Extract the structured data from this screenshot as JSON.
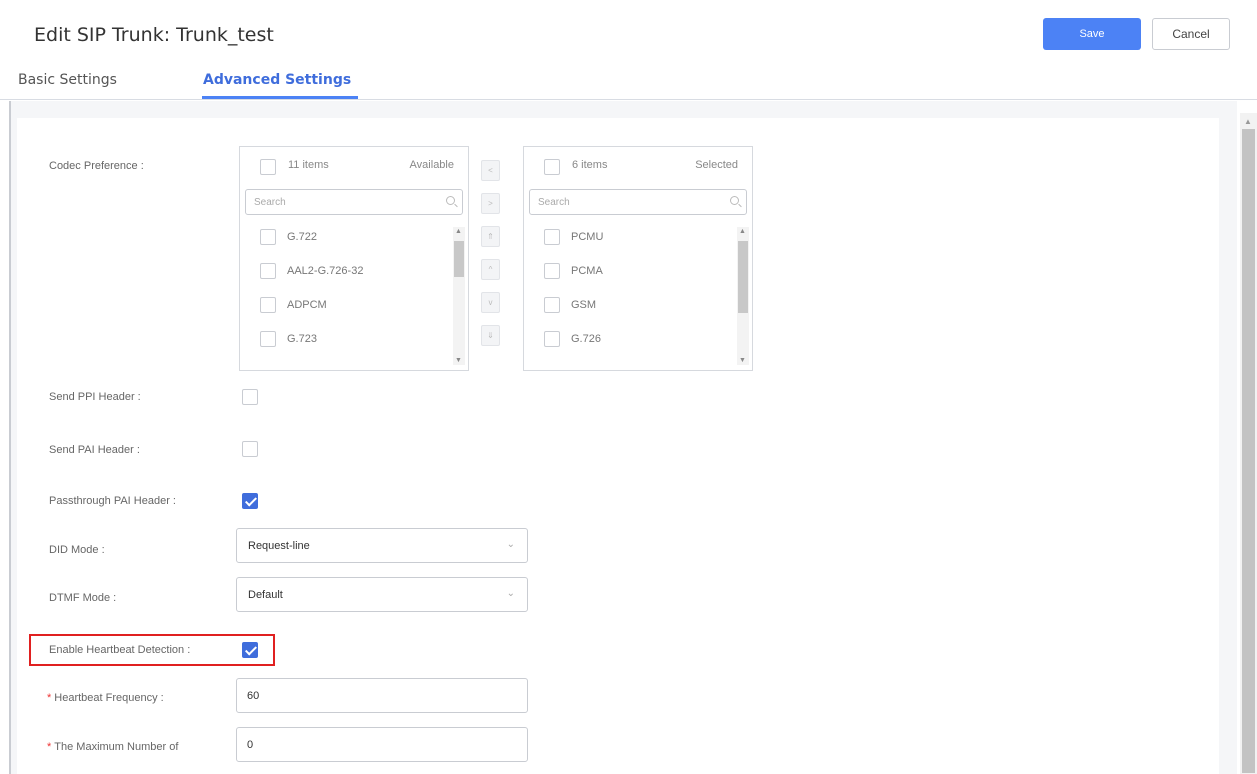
{
  "header": {
    "title": "Edit SIP Trunk: Trunk_test",
    "save_label": "Save",
    "cancel_label": "Cancel"
  },
  "tabs": [
    {
      "label": "Basic Settings",
      "active": false
    },
    {
      "label": "Advanced Settings",
      "active": true
    }
  ],
  "codec": {
    "label": "Codec Preference :",
    "available": {
      "count": "11 items",
      "title": "Available",
      "placeholder": "Search",
      "items": [
        "G.722",
        "AAL2-G.726-32",
        "ADPCM",
        "G.723"
      ]
    },
    "selected": {
      "count": "6 items",
      "title": "Selected",
      "placeholder": "Search",
      "items": [
        "PCMU",
        "PCMA",
        "GSM",
        "G.726"
      ]
    },
    "move_buttons": [
      "<",
      ">",
      "⇑",
      "^",
      "v",
      "⇓"
    ]
  },
  "fields": {
    "send_ppi": {
      "label": "Send PPI Header :",
      "checked": false
    },
    "send_pai": {
      "label": "Send PAI Header :",
      "checked": false
    },
    "passthrough_pai": {
      "label": "Passthrough PAI Header :",
      "checked": true
    },
    "did_mode": {
      "label": "DID Mode :",
      "value": "Request-line"
    },
    "dtmf_mode": {
      "label": "DTMF Mode :",
      "value": "Default"
    },
    "heartbeat_detection": {
      "label": "Enable Heartbeat Detection :",
      "checked": true
    },
    "heartbeat_frequency": {
      "label": "Heartbeat Frequency :",
      "value": "60"
    },
    "max_number": {
      "label": "The Maximum Number of",
      "value": "0"
    }
  },
  "colors": {
    "accent": "#4c82f5",
    "highlight": "#e02020",
    "required": "#ee3333"
  }
}
